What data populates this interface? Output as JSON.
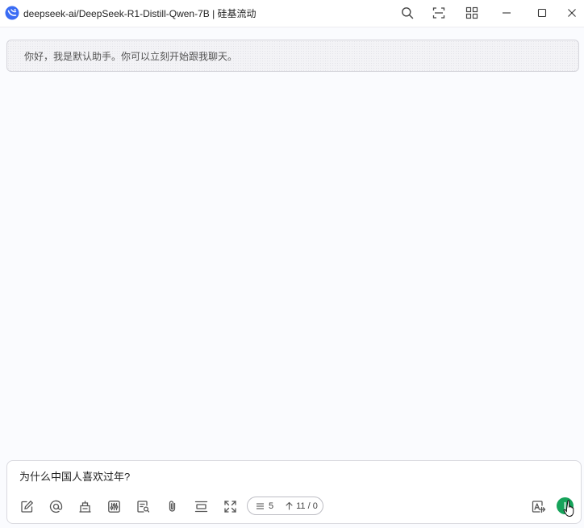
{
  "window": {
    "title": "deepseek-ai/DeepSeek-R1-Distill-Qwen-7B | 硅基流动",
    "logo_icon": "cherry-studio-logo-icon",
    "buttons": [
      "search-icon",
      "scan-icon",
      "grid-apps-icon",
      "minimize-icon",
      "maximize-icon",
      "close-icon"
    ]
  },
  "conversation": {
    "assistant_greeting": "你好，我是默认助手。你可以立刻开始跟我聊天。"
  },
  "input": {
    "value": "为什么中国人喜欢过年?",
    "toolbar_icons": [
      "new-topic-icon",
      "mention-icon",
      "knowledge-base-icon",
      "settings-sliders-icon",
      "web-search-icon",
      "attachment-icon",
      "clear-context-icon",
      "expand-icon"
    ],
    "context_count": "5",
    "token_count": "11 / 0",
    "right_icons": [
      "translate-icon",
      "send-icon"
    ]
  },
  "colors": {
    "accent": "#16a35a",
    "logo": "#3a6cf4"
  }
}
